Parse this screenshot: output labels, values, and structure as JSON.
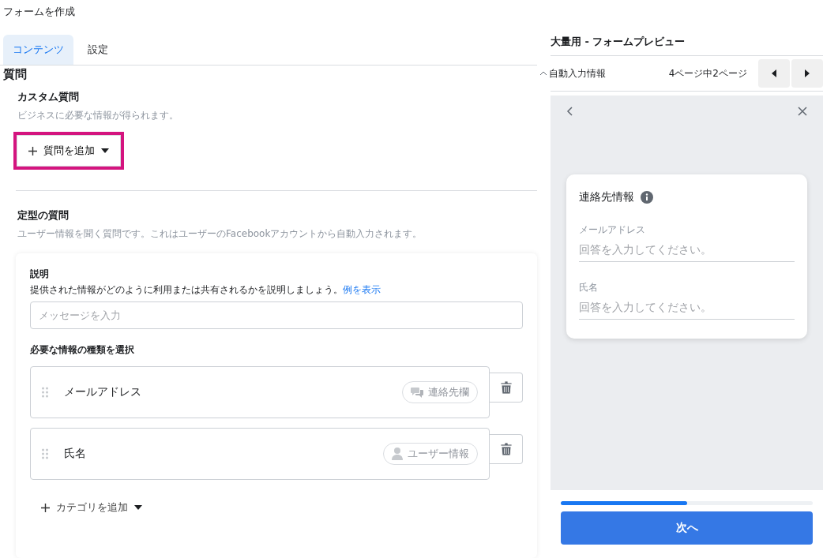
{
  "page_title": "フォームを作成",
  "tabs": [
    {
      "label": "コンテンツ",
      "selected": true
    },
    {
      "label": "設定",
      "selected": false
    }
  ],
  "section_title": "質問",
  "custom": {
    "title": "カスタム質問",
    "description": "ビジネスに必要な情報が得られます。",
    "add_button": {
      "label": "質問を追加",
      "highlighted": true
    }
  },
  "standard": {
    "title": "定型の質問",
    "description": "ユーザー情報を聞く質問です。これはユーザーのFacebookアカウントから自動入力されます。",
    "card": {
      "explain_label": "説明",
      "explain_help": "提供された情報がどのように利用または共有されるかを説明しましょう。",
      "example_link": "例を表示",
      "message_placeholder": "メッセージを入力",
      "select_label": "必要な情報の種類を選択",
      "items": [
        {
          "label": "メールアドレス",
          "tag": "連絡先欄",
          "kind": "contact"
        },
        {
          "label": "氏名",
          "tag": "ユーザー情報",
          "kind": "user"
        }
      ],
      "add_category": "カテゴリを追加"
    }
  },
  "preview": {
    "title": "大量用 - フォームプレビュー",
    "section": "自動入力情報",
    "page_indicator": "4ページ中2ページ",
    "card": {
      "title": "連絡先情報",
      "fields": [
        {
          "label": "メールアドレス",
          "placeholder": "回答を入力してください。"
        },
        {
          "label": "氏名",
          "placeholder": "回答を入力してください。"
        }
      ]
    },
    "progress": {
      "level": 0.5
    },
    "next_button": "次へ"
  }
}
